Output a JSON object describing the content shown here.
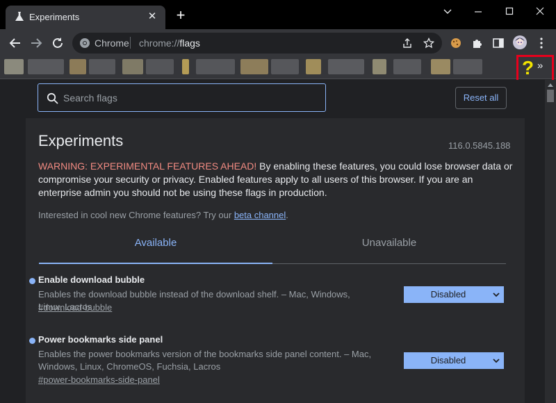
{
  "browser": {
    "tab_title": "Experiments",
    "tab_close": "✕",
    "new_tab": "+",
    "omnibox_label": "Chrome",
    "url_prefix": "chrome://",
    "url_host": "flags"
  },
  "bookmarks": {
    "help_label": "?",
    "more_label": "»"
  },
  "flags_page": {
    "search_placeholder": "Search flags",
    "reset_label": "Reset all",
    "title": "Experiments",
    "version": "116.0.5845.188",
    "warning_prefix": "WARNING: EXPERIMENTAL FEATURES AHEAD!",
    "warning_text": " By enabling these features, you could lose browser data or compromise your security or privacy. Enabled features apply to all users of this browser. If you are an enterprise admin you should not be using these flags in production.",
    "interest_text": "Interested in cool new Chrome features? Try our ",
    "interest_link": "beta channel",
    "interest_suffix": ".",
    "tabs": [
      {
        "label": "Available",
        "active": true
      },
      {
        "label": "Unavailable",
        "active": false
      }
    ],
    "flags": [
      {
        "name": "Enable download bubble",
        "description": "Enables the download bubble instead of the download shelf. – Mac, Windows, Linux, Lacros",
        "link": "#download-bubble",
        "value": "Disabled"
      },
      {
        "name": "Power bookmarks side panel",
        "description": "Enables the power bookmarks version of the bookmarks side panel content. – Mac, Windows, Linux, ChromeOS, Fuchsia, Lacros",
        "link": "#power-bookmarks-side-panel",
        "value": "Disabled"
      }
    ]
  },
  "colors": {
    "accent": "#8ab4f8",
    "warning": "#f28b82",
    "highlight_box": "#e8001c",
    "help_icon": "#f1e300"
  }
}
